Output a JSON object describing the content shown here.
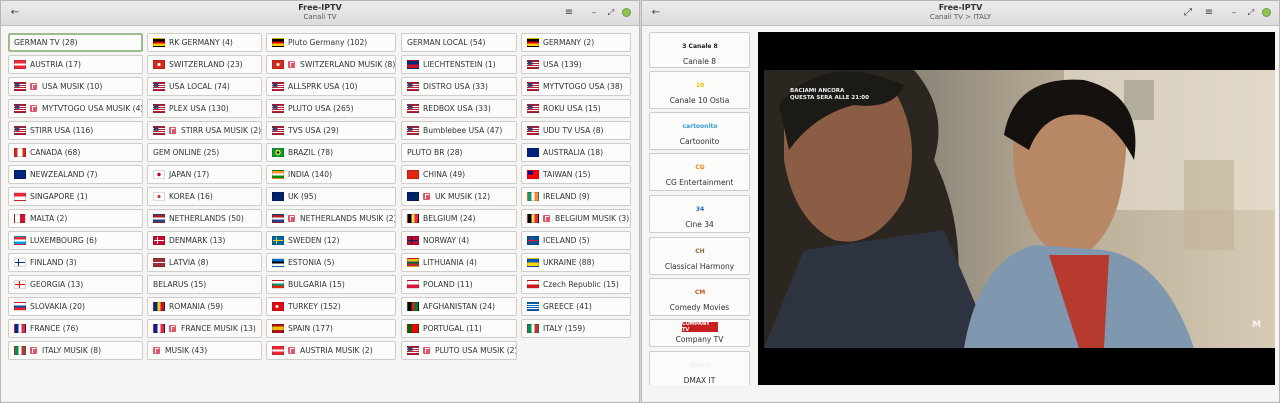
{
  "colors": {
    "selected_border": "#9cbb90",
    "window_bg": "#f6f5f4",
    "music_badge": "#e0556b",
    "close_button": "#8fc35a"
  },
  "left_window": {
    "title": "Free-IPTV",
    "subtitle": "Canali TV",
    "buttons": {
      "back": "←",
      "menu": "≡",
      "minimize": "–",
      "maximize": "⤢"
    },
    "playlists": [
      {
        "label": "GERMAN TV (28)",
        "selected": true
      },
      {
        "label": "RK GERMANY (4)",
        "flag": "de"
      },
      {
        "label": "Pluto Germany (102)",
        "flag": "de"
      },
      {
        "label": "GERMAN LOCAL (54)"
      },
      {
        "label": "GERMANY (2)",
        "flag": "de"
      },
      {
        "label": "AUSTRIA (17)",
        "flag": "at"
      },
      {
        "label": "SWITZERLAND (23)",
        "flag": "ch"
      },
      {
        "label": "SWITZERLAND MUSIK (8)",
        "flag": "ch",
        "music": true
      },
      {
        "label": "LIECHTENSTEIN (1)",
        "flag": "li"
      },
      {
        "label": "USA (139)",
        "flag": "us"
      },
      {
        "label": "USA MUSIK (10)",
        "flag": "us",
        "music": true
      },
      {
        "label": "USA LOCAL (74)",
        "flag": "us"
      },
      {
        "label": "ALLSPRK USA (10)",
        "flag": "us"
      },
      {
        "label": "DISTRO USA (33)",
        "flag": "us"
      },
      {
        "label": "MYTVTOGO USA (38)",
        "flag": "us"
      },
      {
        "label": "MYTVTOGO USA MUSIK (4)",
        "flag": "us",
        "music": true
      },
      {
        "label": "PLEX USA (130)",
        "flag": "us"
      },
      {
        "label": "PLUTO USA (265)",
        "flag": "us"
      },
      {
        "label": "REDBOX USA (33)",
        "flag": "us"
      },
      {
        "label": "ROKU USA (15)",
        "flag": "us"
      },
      {
        "label": "STIRR USA (116)",
        "flag": "us"
      },
      {
        "label": "STIRR USA MUSIK (2)",
        "flag": "us",
        "music": true
      },
      {
        "label": "TVS USA (29)",
        "flag": "us"
      },
      {
        "label": "Bumblebee USA (47)",
        "flag": "us"
      },
      {
        "label": "UDU TV USA (8)",
        "flag": "us"
      },
      {
        "label": "CANADA (68)",
        "flag": "ca"
      },
      {
        "label": "GEM ONLINE (25)"
      },
      {
        "label": "BRAZIL (78)",
        "flag": "br"
      },
      {
        "label": "PLUTO BR (28)"
      },
      {
        "label": "AUSTRALIA (18)",
        "flag": "au"
      },
      {
        "label": "NEWZEALAND (7)",
        "flag": "nz"
      },
      {
        "label": "JAPAN (17)",
        "flag": "jp"
      },
      {
        "label": "INDIA (140)",
        "flag": "in"
      },
      {
        "label": "CHINA (49)",
        "flag": "cn"
      },
      {
        "label": "TAIWAN (15)",
        "flag": "tw"
      },
      {
        "label": "SINGAPORE (1)",
        "flag": "sg"
      },
      {
        "label": "KOREA (16)",
        "flag": "kr"
      },
      {
        "label": "UK (95)",
        "flag": "gb"
      },
      {
        "label": "UK MUSIK (12)",
        "flag": "gb",
        "music": true
      },
      {
        "label": "IRELAND (9)",
        "flag": "ie"
      },
      {
        "label": "MALTA (2)",
        "flag": "mt"
      },
      {
        "label": "NETHERLANDS (50)",
        "flag": "nl"
      },
      {
        "label": "NETHERLANDS MUSIK (2)",
        "flag": "nl",
        "music": true
      },
      {
        "label": "BELGIUM (24)",
        "flag": "be"
      },
      {
        "label": "BELGIUM MUSIK (3)",
        "flag": "be",
        "music": true
      },
      {
        "label": "LUXEMBOURG (6)",
        "flag": "lu"
      },
      {
        "label": "DENMARK (13)",
        "flag": "dk"
      },
      {
        "label": "SWEDEN (12)",
        "flag": "se"
      },
      {
        "label": "NORWAY (4)",
        "flag": "no"
      },
      {
        "label": "ICELAND (5)",
        "flag": "is"
      },
      {
        "label": "FINLAND (3)",
        "flag": "fi"
      },
      {
        "label": "LATVIA (8)",
        "flag": "lv"
      },
      {
        "label": "ESTONIA (5)",
        "flag": "ee"
      },
      {
        "label": "LITHUANIA (4)",
        "flag": "lt"
      },
      {
        "label": "UKRAINE (88)",
        "flag": "ua"
      },
      {
        "label": "GEORGIA (13)",
        "flag": "ge"
      },
      {
        "label": "BELARUS (15)"
      },
      {
        "label": "BULGARIA (15)",
        "flag": "bg"
      },
      {
        "label": "POLAND (11)",
        "flag": "pl"
      },
      {
        "label": "Czech Republic (15)",
        "flag": "cz"
      },
      {
        "label": "SLOVAKIA (20)",
        "flag": "sk"
      },
      {
        "label": "ROMANIA (59)",
        "flag": "ro"
      },
      {
        "label": "TURKEY (152)",
        "flag": "tr"
      },
      {
        "label": "AFGHANISTAN (24)",
        "flag": "af"
      },
      {
        "label": "GREECE (41)",
        "flag": "gr"
      },
      {
        "label": "FRANCE (76)",
        "flag": "fr"
      },
      {
        "label": "FRANCE MUSIK (13)",
        "flag": "fr",
        "music": true
      },
      {
        "label": "SPAIN (177)",
        "flag": "es"
      },
      {
        "label": "PORTUGAL (11)",
        "flag": "pt"
      },
      {
        "label": "ITALY (159)",
        "flag": "it"
      },
      {
        "label": "ITALY MUSIK (8)",
        "flag": "it",
        "music": true
      },
      {
        "label": "MUSIK (43)",
        "music": true
      },
      {
        "label": "AUSTRIA MUSIK (2)",
        "flag": "at",
        "music": true
      },
      {
        "label": "PLUTO USA MUSIK (2)",
        "flag": "us",
        "music": true
      }
    ]
  },
  "right_window": {
    "title": "Free-IPTV",
    "subtitle": "Canali TV > ITALY",
    "buttons": {
      "back": "←",
      "fullscreen": "⤢",
      "menu": "≡",
      "minimize": "–",
      "maximize": "⤢"
    },
    "channels": [
      {
        "name": "Canale 8",
        "logo_text": "3 Canale 8",
        "logo_color": "#1a1a1a"
      },
      {
        "name": "Canale 10 Ostia",
        "logo_text": "10",
        "logo_color": "#e3c300"
      },
      {
        "name": "Cartoonito",
        "logo_text": "cartoonito",
        "logo_color": "#3a9bd8"
      },
      {
        "name": "CG Entertainment",
        "logo_text": "CG",
        "logo_color": "#e48a12"
      },
      {
        "name": "Cine 34",
        "logo_text": "34",
        "logo_color": "#1f6ab0"
      },
      {
        "name": "Classical Harmony",
        "logo_text": "CH",
        "logo_color": "#8a6a3a"
      },
      {
        "name": "Comedy Movies",
        "logo_text": "CM",
        "logo_color": "#c05a18"
      },
      {
        "name": "Company TV",
        "logo_text": "COMPANY TV",
        "logo_color": "#c8201e"
      },
      {
        "name": "DMAX IT",
        "logo_text": "DMAX",
        "logo_color": "#dddddd"
      }
    ],
    "video": {
      "overlay_line1": "BACIAMI ANCORA",
      "overlay_line2": "QUESTA SERA ALLE 21:00",
      "watermark": "M"
    }
  }
}
